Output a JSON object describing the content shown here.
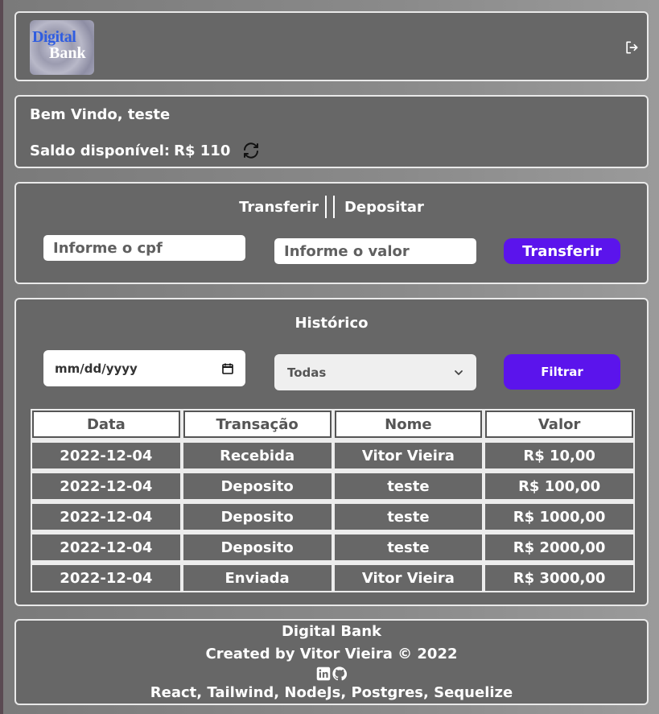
{
  "header": {
    "logo_line1": "Digital",
    "logo_line2": "Bank",
    "logout_icon": "logout-icon"
  },
  "welcome": {
    "greeting": "Bem Vindo, teste",
    "balance_label": "Saldo disponível:",
    "balance_value": "R$ 110",
    "refresh_icon": "refresh-icon"
  },
  "transfer": {
    "tabs": [
      "Transferir",
      "Depositar"
    ],
    "cpf_placeholder": "Informe o cpf",
    "value_placeholder": "Informe o valor",
    "button_label": "Transferir"
  },
  "history": {
    "title": "Histórico",
    "date_placeholder": "mm/dd/yyyy",
    "type_selected": "Todas",
    "filter_label": "Filtrar",
    "columns": [
      "Data",
      "Transação",
      "Nome",
      "Valor"
    ],
    "rows": [
      [
        "2022-12-04",
        "Recebida",
        "Vitor Vieira",
        "R$ 10,00"
      ],
      [
        "2022-12-04",
        "Deposito",
        "teste",
        "R$ 100,00"
      ],
      [
        "2022-12-04",
        "Deposito",
        "teste",
        "R$ 1000,00"
      ],
      [
        "2022-12-04",
        "Deposito",
        "teste",
        "R$ 2000,00"
      ],
      [
        "2022-12-04",
        "Enviada",
        "Vitor Vieira",
        "R$ 3000,00"
      ]
    ]
  },
  "footer": {
    "brand": "Digital Bank",
    "credits": "Created by Vitor Vieira © 2022",
    "icons": [
      "linkedin-icon",
      "github-icon"
    ],
    "stack": "React, Tailwind, NodeJs, Postgres, Sequelize"
  },
  "colors": {
    "card_bg": "#676767",
    "border": "#e9e9e9",
    "accent": "#5b14ec"
  }
}
